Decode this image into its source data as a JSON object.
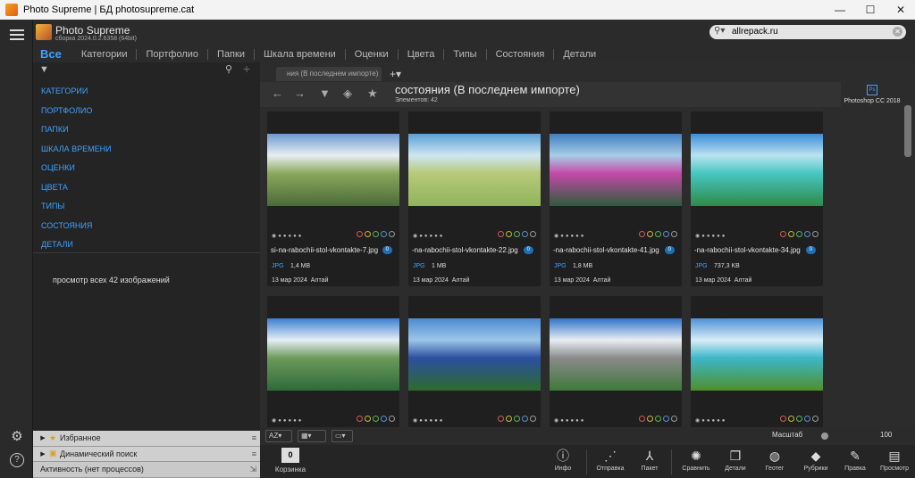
{
  "window": {
    "title": "Photo Supreme | БД photosupreme.cat",
    "minimize": "—",
    "maximize": "☐",
    "close": "✕"
  },
  "app": {
    "name": "Photo Supreme",
    "build": "сборка 2024.0.2.6358 (64bit)"
  },
  "nav": {
    "tabs": [
      {
        "label": "Все",
        "active": true
      },
      {
        "label": "Категории"
      },
      {
        "label": "Портфолио"
      },
      {
        "label": "Папки"
      },
      {
        "label": "Шкала времени"
      },
      {
        "label": "Оценки"
      },
      {
        "label": "Цвета"
      },
      {
        "label": "Типы"
      },
      {
        "label": "Состояния"
      },
      {
        "label": "Детали"
      }
    ]
  },
  "search": {
    "value": "allrepack.ru",
    "icon": "search-icon"
  },
  "sidebar": {
    "sections": [
      "КАТЕГОРИИ",
      "ПОРТФОЛИО",
      "ПАПКИ",
      "ШКАЛА ВРЕМЕНИ",
      "ОЦЕНКИ",
      "ЦВЕТА",
      "ТИПЫ",
      "СОСТОЯНИЯ",
      "ДЕТАЛИ"
    ],
    "view_all": "просмотр всех 42 изображений"
  },
  "bottom_panels": [
    {
      "label": "Избранное",
      "icon": "star-icon"
    },
    {
      "label": "Динамический поиск",
      "icon": "folder-icon"
    },
    {
      "label": "Активность (нет процессов)",
      "icon": "collapse-icon"
    }
  ],
  "collection": {
    "tab_label": "ния (В последнем импорте)",
    "title": "состояния (В последнем импорте)",
    "count": "Элементов: 42"
  },
  "external_app": {
    "badge": "Ps",
    "label": "Photoshop CC 2018"
  },
  "thumbnails": [
    {
      "file": "si-na-rabochii-stol-vkontakte-7.jpg",
      "badge": "0",
      "type": "JPG",
      "size": "1,4 MB",
      "date": "13 мар 2024",
      "place": "Алтай",
      "palette": [
        "#6b9bd1",
        "#e8eef2",
        "#4b6a3a",
        "#8aa85a"
      ]
    },
    {
      "file": "-na-rabochii-stol-vkontakte-22.jpg",
      "badge": "0",
      "type": "JPG",
      "size": "1 MB",
      "date": "13 мар 2024",
      "place": "Алтай",
      "palette": [
        "#5aa0d6",
        "#cfe6f0",
        "#8fb45a",
        "#b7c97a"
      ]
    },
    {
      "file": "-na-rabochii-stol-vkontakte-41.jpg",
      "badge": "0",
      "type": "JPG",
      "size": "1,8 MB",
      "date": "13 мар 2024",
      "place": "Алтай",
      "palette": [
        "#3f7fc2",
        "#a7cde6",
        "#2e5b3a",
        "#c34aa8"
      ]
    },
    {
      "file": "-na-rabochii-stol-vkontakte-34.jpg",
      "badge": "0",
      "type": "JPG",
      "size": "737,3 KB",
      "date": "13 мар 2024",
      "place": "Алтай",
      "palette": [
        "#3d8cd8",
        "#b9e3f0",
        "#2f8a4a",
        "#46c7c0"
      ]
    },
    {
      "palette": [
        "#3b7fd0",
        "#e6eef5",
        "#2f6a3a",
        "#6b9a5a"
      ]
    },
    {
      "palette": [
        "#4c8ad0",
        "#9cc6e8",
        "#2d6a2d",
        "#2c4fa0"
      ]
    },
    {
      "palette": [
        "#2f72c8",
        "#e8eef3",
        "#3e7a3a",
        "#8a8a8a"
      ]
    },
    {
      "palette": [
        "#4d92d8",
        "#d8ecf6",
        "#4f8f2a",
        "#3cb7c9"
      ]
    }
  ],
  "rating_colors": [
    "#d35b5b",
    "#c9b93b",
    "#5bb35b",
    "#5b8fd3",
    "#9a9a9a"
  ],
  "toolbar": {
    "sort": "AZ",
    "zoom_label": "Масштаб",
    "zoom_value": "100"
  },
  "actions": {
    "basket_count": "0",
    "basket_label": "Корзинка",
    "items": [
      {
        "label": "Инфо",
        "icon": "info-icon"
      },
      {
        "label": "Отправка",
        "icon": "share-icon"
      },
      {
        "label": "Пакет",
        "icon": "batch-icon"
      },
      {
        "label": "Сравнить",
        "icon": "bulb-icon"
      },
      {
        "label": "Детали",
        "icon": "book-icon"
      },
      {
        "label": "Геотег",
        "icon": "globe-icon"
      },
      {
        "label": "Рубрики",
        "icon": "tag-icon"
      },
      {
        "label": "Правка",
        "icon": "brush-icon"
      },
      {
        "label": "Просмотр",
        "icon": "viewer-icon"
      }
    ]
  }
}
